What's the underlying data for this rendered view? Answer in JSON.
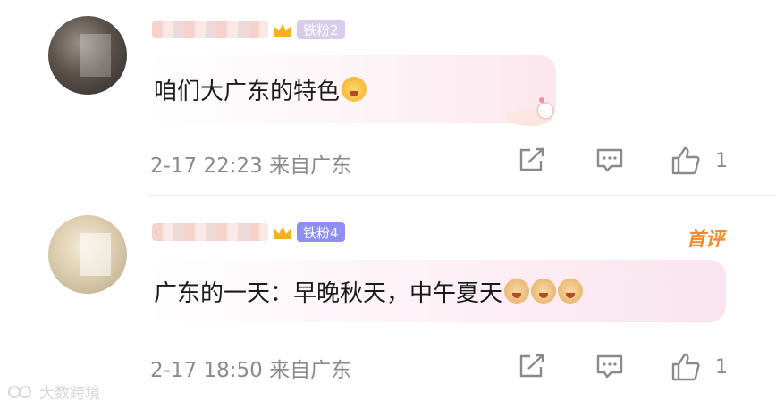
{
  "comments": [
    {
      "text": "咱们大广东的特色",
      "badge": "铁粉2",
      "date": "2-17 22:23",
      "location": "来自广东",
      "likes": "1",
      "emojis": [
        "happy-face-emoji"
      ]
    },
    {
      "text": "广东的一天：早晚秋天，中午夏天",
      "badge": "铁粉4",
      "tag": "首评",
      "date": "2-17 18:50",
      "location": "来自广东",
      "likes": "1",
      "emojis": [
        "doge-emoji",
        "doge-emoji",
        "doge-emoji"
      ]
    }
  ],
  "watermark": "大数跨境",
  "colors": {
    "badge": "#8e8ff0",
    "first_comment": "#f08a2a",
    "meta": "#8a8a8a"
  },
  "icons": [
    "share-icon",
    "comment-icon",
    "like-icon",
    "crown-icon"
  ]
}
